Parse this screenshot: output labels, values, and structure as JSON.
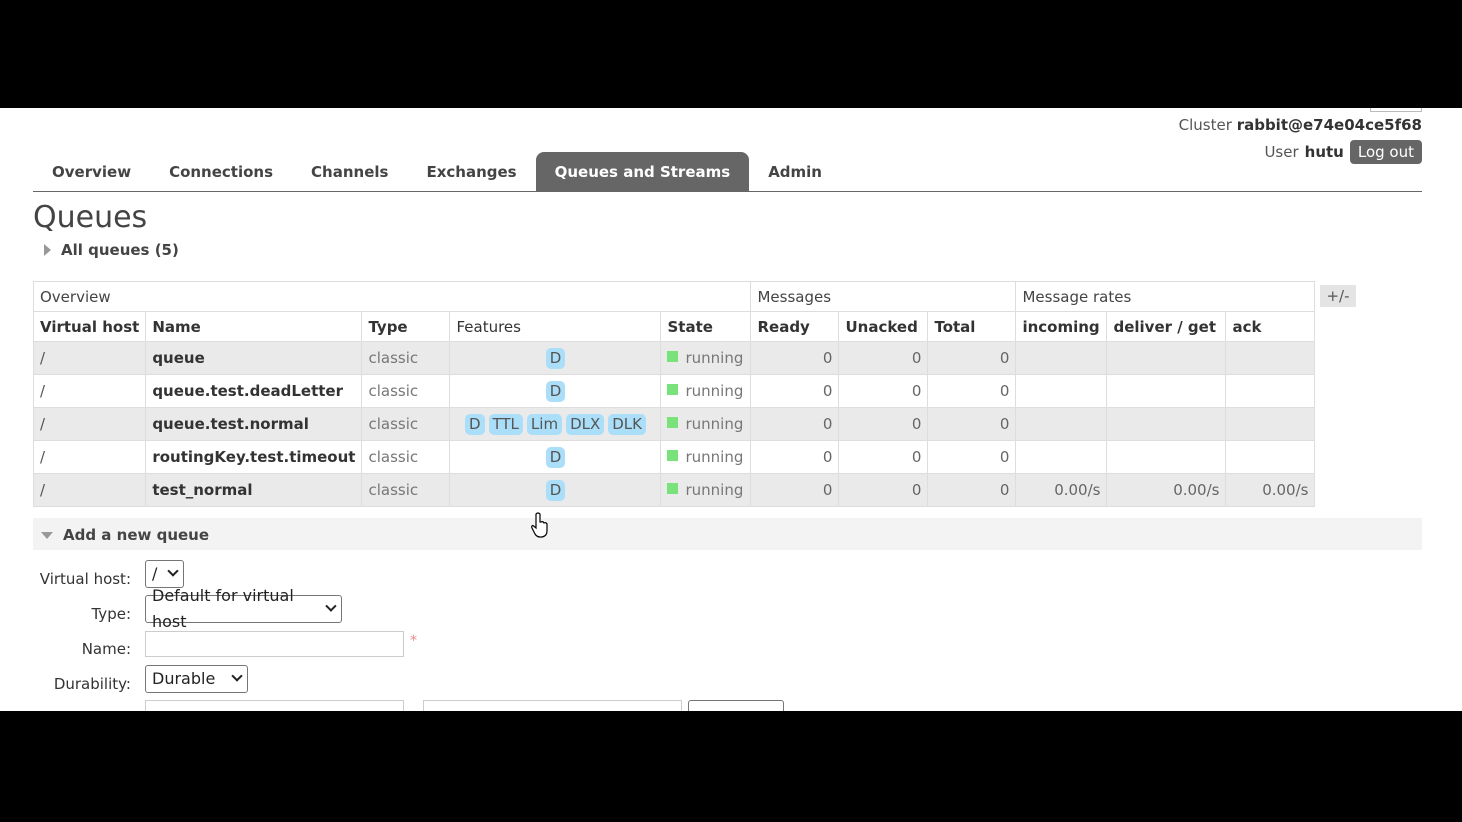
{
  "header": {
    "cluster_label": "Cluster",
    "cluster_name": "rabbit@e74e04ce5f68",
    "user_label": "User",
    "user_name": "hutu",
    "logout_label": "Log out"
  },
  "tabs": [
    {
      "label": "Overview",
      "active": false
    },
    {
      "label": "Connections",
      "active": false
    },
    {
      "label": "Channels",
      "active": false
    },
    {
      "label": "Exchanges",
      "active": false
    },
    {
      "label": "Queues and Streams",
      "active": true
    },
    {
      "label": "Admin",
      "active": false
    }
  ],
  "page": {
    "title": "Queues",
    "all_queues_label": "All queues (5)"
  },
  "table": {
    "groups": {
      "overview": "Overview",
      "messages": "Messages",
      "rates": "Message rates"
    },
    "columns": [
      "Virtual host",
      "Name",
      "Type",
      "Features",
      "State",
      "Ready",
      "Unacked",
      "Total",
      "incoming",
      "deliver / get",
      "ack"
    ],
    "toggle_label": "+/-",
    "rows": [
      {
        "vhost": "/",
        "name": "queue",
        "type": "classic",
        "features": [
          "D"
        ],
        "state": "running",
        "ready": "0",
        "unacked": "0",
        "total": "0",
        "incoming": "",
        "deliver": "",
        "ack": ""
      },
      {
        "vhost": "/",
        "name": "queue.test.deadLetter",
        "type": "classic",
        "features": [
          "D"
        ],
        "state": "running",
        "ready": "0",
        "unacked": "0",
        "total": "0",
        "incoming": "",
        "deliver": "",
        "ack": ""
      },
      {
        "vhost": "/",
        "name": "queue.test.normal",
        "type": "classic",
        "features": [
          "D",
          "TTL",
          "Lim",
          "DLX",
          "DLK"
        ],
        "state": "running",
        "ready": "0",
        "unacked": "0",
        "total": "0",
        "incoming": "",
        "deliver": "",
        "ack": ""
      },
      {
        "vhost": "/",
        "name": "routingKey.test.timeout",
        "type": "classic",
        "features": [
          "D"
        ],
        "state": "running",
        "ready": "0",
        "unacked": "0",
        "total": "0",
        "incoming": "",
        "deliver": "",
        "ack": ""
      },
      {
        "vhost": "/",
        "name": "test_normal",
        "type": "classic",
        "features": [
          "D"
        ],
        "state": "running",
        "ready": "0",
        "unacked": "0",
        "total": "0",
        "incoming": "0.00/s",
        "deliver": "0.00/s",
        "ack": "0.00/s"
      }
    ]
  },
  "add_queue": {
    "section_label": "Add a new queue",
    "vhost_label": "Virtual host:",
    "vhost_value": "/",
    "type_label": "Type:",
    "type_value": "Default for virtual host",
    "name_label": "Name:",
    "name_value": "",
    "required_mark": "*",
    "durability_label": "Durability:",
    "durability_value": "Durable"
  },
  "colors": {
    "tab_active": "#666666",
    "feature_badge": "#abdef8",
    "state_running": "#7ae27a"
  }
}
